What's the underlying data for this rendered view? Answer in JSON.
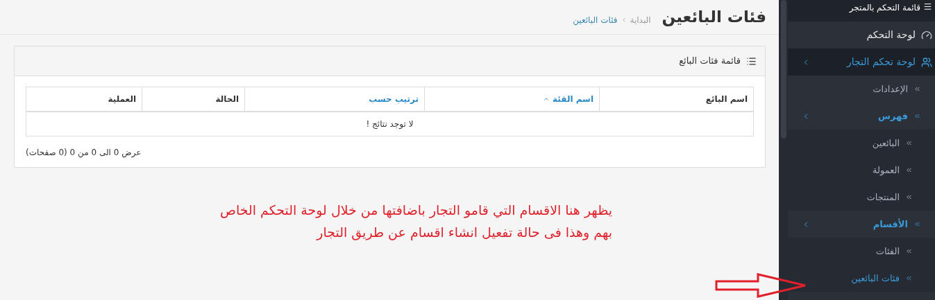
{
  "page": {
    "title": "فئات البائعين",
    "breadcrumb": [
      {
        "label": "البداية",
        "selected": false
      },
      {
        "label": "فئات البائعين",
        "selected": true
      }
    ]
  },
  "panel": {
    "title": "قائمة فئات البائع",
    "table": {
      "columns": [
        {
          "label": "اسم البائع",
          "sortable": false,
          "sorted": false
        },
        {
          "label": "اسم الفئة",
          "sortable": true,
          "sorted": true
        },
        {
          "label": "ترتيب حسب",
          "sortable": true,
          "sorted": false
        },
        {
          "label": "الحالة",
          "sortable": false,
          "sorted": false
        },
        {
          "label": "العملية",
          "sortable": false,
          "sorted": false
        }
      ],
      "empty_message": "لا توجد نتائج !"
    },
    "pagination_info": "عرض 0 الى 0 من 0 (0 صفحات)"
  },
  "annotation": {
    "lines": [
      "يظهر هنا الاقسام التي قامو التجار باضافتها من خلال لوحة التحكم الخاص",
      "بهم وهذا فى حالة تفعيل انشاء اقسام عن طريق التجار"
    ]
  },
  "sidebar": {
    "title": "قائمة التحكم بالمتجر",
    "items": [
      {
        "label": "لوحة التحكم",
        "kind": "dashboard",
        "expanded": false,
        "selected": false
      },
      {
        "label": "لوحة تحكم التجار",
        "kind": "users",
        "expanded": true,
        "selected": false,
        "children": [
          {
            "label": "الإعدادات",
            "selected": false
          },
          {
            "label": "فهرس",
            "expanded": true,
            "children": [
              {
                "label": "البائعين",
                "selected": false
              },
              {
                "label": "العمولة",
                "selected": false
              },
              {
                "label": "المنتجات",
                "selected": false
              }
            ]
          },
          {
            "label": "الأقسام",
            "expanded": true,
            "children": [
              {
                "label": "الفئات",
                "selected": false
              },
              {
                "label": "فئات البائعين",
                "selected": true
              }
            ]
          }
        ]
      }
    ]
  }
}
